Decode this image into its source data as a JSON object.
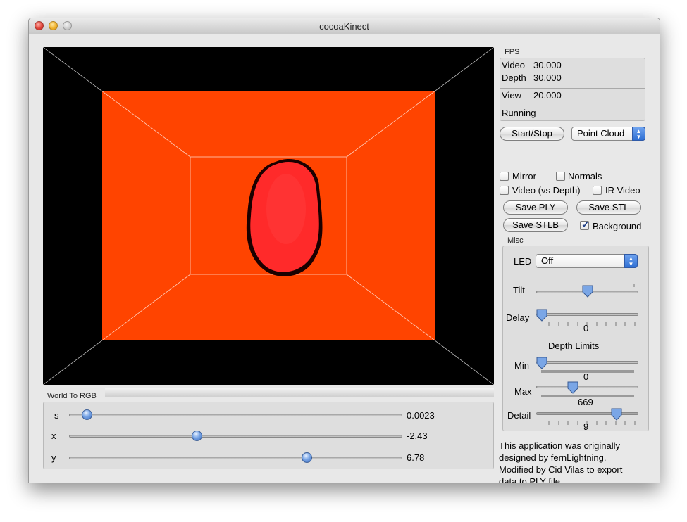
{
  "window": {
    "title": "cocoaKinect"
  },
  "world_to_rgb": {
    "title": "World To RGB",
    "sliders": [
      {
        "label": "s",
        "value_text": "0.0023",
        "fraction": 0.04
      },
      {
        "label": "x",
        "value_text": "-2.43",
        "fraction": 0.38
      },
      {
        "label": "y",
        "value_text": "6.78",
        "fraction": 0.72
      }
    ]
  },
  "fps": {
    "title": "FPS",
    "video_label": "Video",
    "video_value": "30.000",
    "depth_label": "Depth",
    "depth_value": "30.000",
    "view_label": "View",
    "view_value": "20.000",
    "status": "Running"
  },
  "controls": {
    "start_stop": "Start/Stop",
    "mode_selected": "Point Cloud",
    "mirror": {
      "label": "Mirror",
      "checked": false
    },
    "normals": {
      "label": "Normals",
      "checked": false
    },
    "video_vs_depth": {
      "label": "Video (vs Depth)",
      "checked": false
    },
    "ir_video": {
      "label": "IR Video",
      "checked": false
    },
    "save_ply": "Save PLY",
    "save_stl": "Save STL",
    "save_stlb": "Save STLB",
    "background": {
      "label": "Background",
      "checked": true
    }
  },
  "misc": {
    "title": "Misc",
    "led_label": "LED",
    "led_value": "Off",
    "tilt_label": "Tilt",
    "tilt_fraction": 0.5,
    "delay_label": "Delay",
    "delay_value": "0",
    "delay_fraction": 0.0
  },
  "depth_limits": {
    "title": "Depth Limits",
    "min_label": "Min",
    "min_value": "0",
    "min_fraction": 0.0,
    "max_label": "Max",
    "max_value": "669",
    "max_fraction": 0.34,
    "detail_label": "Detail",
    "detail_value": "9",
    "detail_fraction": 0.82
  },
  "description": "This application was originally designed by fernLightning. Modified by Cid Vilas to export data to PLY file.",
  "colors": {
    "scene_bg": "#ff4400",
    "blob": "#ff2a2a",
    "accent": "#3f6fc0"
  }
}
